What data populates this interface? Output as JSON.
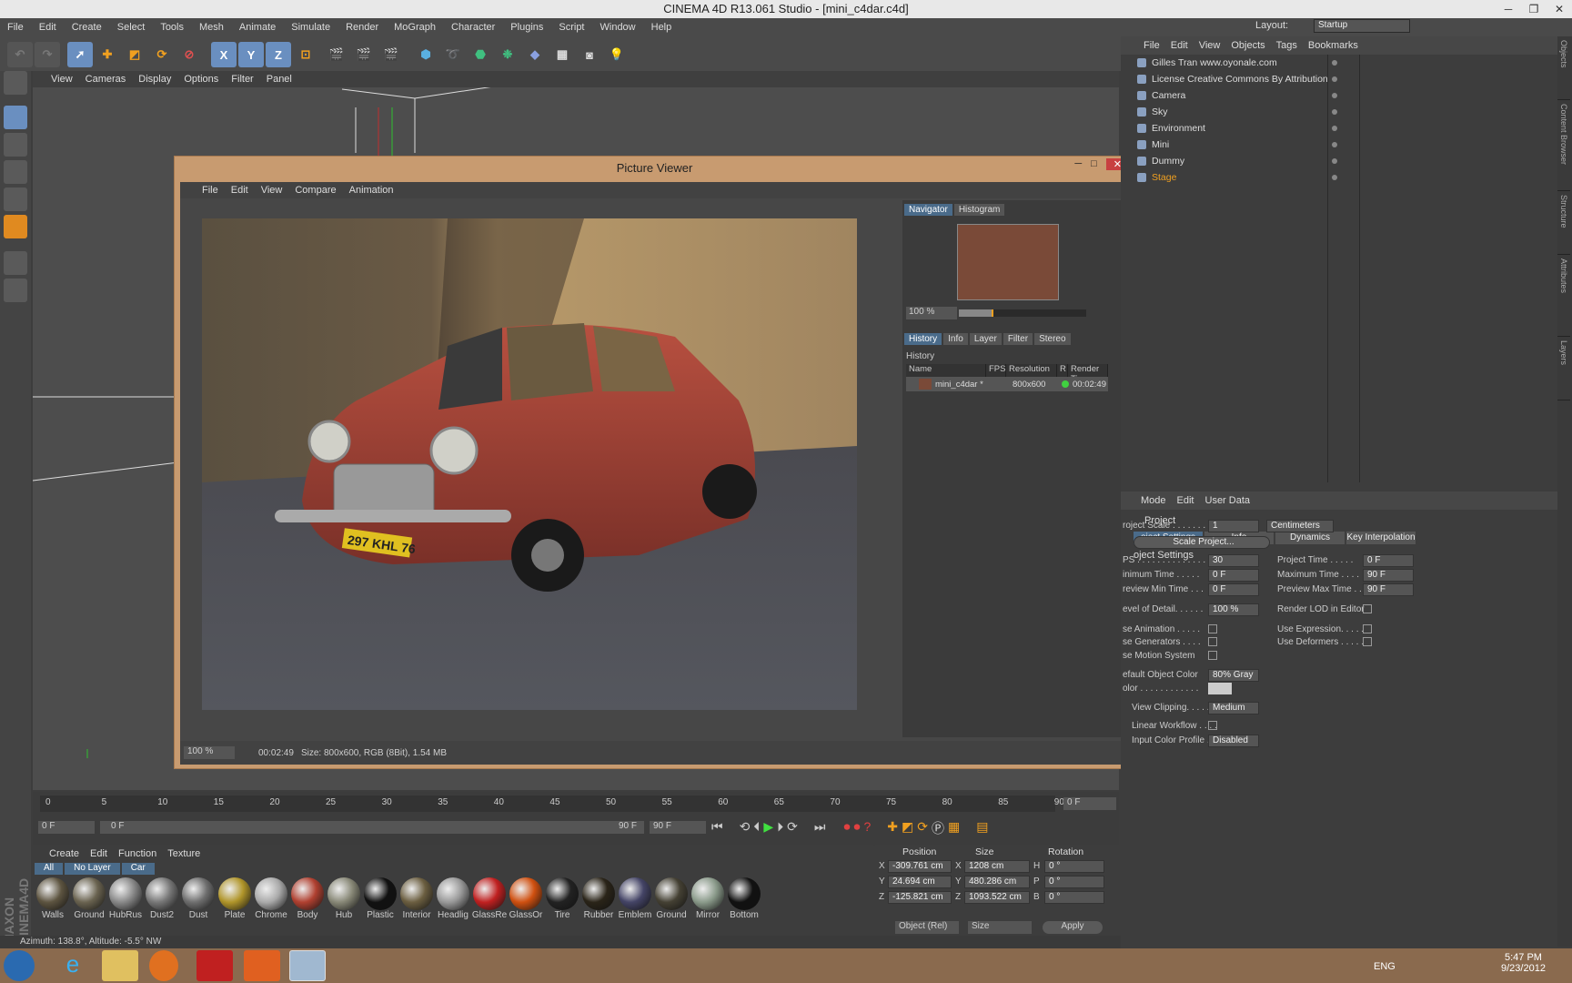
{
  "app": {
    "title": "CINEMA 4D R13.061 Studio - [mini_c4dar.c4d]",
    "layout_label": "Layout:",
    "layout_value": "Startup"
  },
  "menubar": [
    "File",
    "Edit",
    "Create",
    "Select",
    "Tools",
    "Mesh",
    "Animate",
    "Simulate",
    "Render",
    "MoGraph",
    "Character",
    "Plugins",
    "Script",
    "Window",
    "Help"
  ],
  "viewport_menu": [
    "View",
    "Cameras",
    "Display",
    "Options",
    "Filter",
    "Panel"
  ],
  "picture_viewer": {
    "title": "Picture Viewer",
    "menu": [
      "File",
      "Edit",
      "View",
      "Compare",
      "Animation"
    ],
    "nav_tabs": [
      "Navigator",
      "Histogram"
    ],
    "zoom": "100 %",
    "info_tabs": [
      "History",
      "Info",
      "Layer",
      "Filter",
      "Stereo"
    ],
    "history_label": "History",
    "columns": [
      "Name",
      "FPS",
      "Resolution",
      "R",
      "Render Tim"
    ],
    "history_row": {
      "name": "mini_c4dar *",
      "resolution": "800x600",
      "time": "00:02:49"
    },
    "status_zoom": "100 %",
    "status_time": "00:02:49",
    "status_size": "Size: 800x600, RGB (8Bit), 1.54 MB",
    "plate": "297 KHL 76"
  },
  "object_manager": {
    "menu": [
      "File",
      "Edit",
      "View",
      "Objects",
      "Tags",
      "Bookmarks"
    ],
    "objects": [
      "Gilles Tran www.oyonale.com",
      "License Creative Commons By Attribution",
      "Camera",
      "Sky",
      "Environment",
      "Mini",
      "Dummy",
      "Stage"
    ]
  },
  "attributes": {
    "menu": [
      "Mode",
      "Edit",
      "User Data"
    ],
    "section": "Project",
    "tabs": [
      "oject Settings",
      "Info",
      "Dynamics",
      "Key Interpolation"
    ],
    "group": "oject Settings",
    "rows": [
      {
        "label": "roject Scale . . . . . . . .",
        "value": "1",
        "extra": "Centimeters"
      },
      {
        "label": "Scale Project..."
      },
      {
        "label": "PS . . . . . . . . . . . . . .",
        "value": "30",
        "label2": "Project Time . . . . .",
        "value2": "0 F"
      },
      {
        "label": "inimum Time . . . . .",
        "value": "0 F",
        "label2": "Maximum Time . . . .",
        "value2": "90 F"
      },
      {
        "label": "review Min Time . . .",
        "value": "0 F",
        "label2": "Preview Max Time . .",
        "value2": "90 F"
      },
      {
        "label": "evel of Detail. . . . . .",
        "value": "100 %",
        "label2": "Render LOD in Editor"
      },
      {
        "label": "se Animation . . . . .",
        "label2": "Use Expression. . . . ."
      },
      {
        "label": "se Generators . . . .",
        "label2": "Use Deformers . . . . ."
      },
      {
        "label": "se Motion System"
      },
      {
        "label": "efault Object Color",
        "value": "80% Gray"
      },
      {
        "label": "olor . . . . . . . . . . . ."
      },
      {
        "label": "View Clipping. . . . . . .",
        "value": "Medium"
      },
      {
        "label": "Linear Workflow . . . ."
      },
      {
        "label": "Input Color Profile . .",
        "value": "Disabled"
      }
    ]
  },
  "timeline": {
    "ticks": [
      "0",
      "5",
      "10",
      "15",
      "20",
      "25",
      "30",
      "35",
      "40",
      "45",
      "50",
      "55",
      "60",
      "65",
      "70",
      "75",
      "80",
      "85",
      "90"
    ],
    "end_frame": "0 F",
    "start": "0 F",
    "range_start": "0 F",
    "range_end": "90 F",
    "max": "90 F"
  },
  "materials": {
    "menu": [
      "Create",
      "Edit",
      "Function",
      "Texture"
    ],
    "filters": [
      "All",
      "No Layer",
      "Car"
    ],
    "items": [
      {
        "name": "Walls",
        "c": "#5d5440"
      },
      {
        "name": "Ground",
        "c": "#6a6350"
      },
      {
        "name": "HubRus",
        "c": "#888"
      },
      {
        "name": "Dust2",
        "c": "#777"
      },
      {
        "name": "Dust",
        "c": "#6e6e6e"
      },
      {
        "name": "Plate",
        "c": "#b0952a"
      },
      {
        "name": "Chrome",
        "c": "#aaa"
      },
      {
        "name": "Body",
        "c": "#b04030"
      },
      {
        "name": "Hub",
        "c": "#888877"
      },
      {
        "name": "Plastic",
        "c": "#111"
      },
      {
        "name": "Interior",
        "c": "#6b5e40"
      },
      {
        "name": "Headlig",
        "c": "#999"
      },
      {
        "name": "GlassRe",
        "c": "#c02020"
      },
      {
        "name": "GlassOr",
        "c": "#d05010"
      },
      {
        "name": "Tire",
        "c": "#222"
      },
      {
        "name": "Rubber",
        "c": "#2a2418"
      },
      {
        "name": "Emblem",
        "c": "#444466"
      },
      {
        "name": "Ground",
        "c": "#444033"
      },
      {
        "name": "Mirror",
        "c": "#8a9a8a"
      },
      {
        "name": "Bottom",
        "c": "#111"
      }
    ]
  },
  "coords": {
    "headers": [
      "Position",
      "Size",
      "Rotation"
    ],
    "rows": [
      {
        "axis": "X",
        "pos": "-309.761 cm",
        "size": "1208 cm",
        "rl": "H",
        "rot": "0 °"
      },
      {
        "axis": "Y",
        "pos": "24.694 cm",
        "size": "480.286 cm",
        "rl": "P",
        "rot": "0 °"
      },
      {
        "axis": "Z",
        "pos": "-125.821 cm",
        "size": "1093.522 cm",
        "rl": "B",
        "rot": "0 °"
      }
    ],
    "mode": "Object (Rel)",
    "size_mode": "Size",
    "apply": "Apply"
  },
  "status": "Azimuth: 138.8°, Altitude: -5.5°  NW",
  "taskbar": {
    "lang": "ENG",
    "time": "5:47 PM",
    "date": "9/23/2012"
  },
  "vtabs": [
    "Objects",
    "Content Browser",
    "Structure",
    "Attributes",
    "Layers"
  ]
}
